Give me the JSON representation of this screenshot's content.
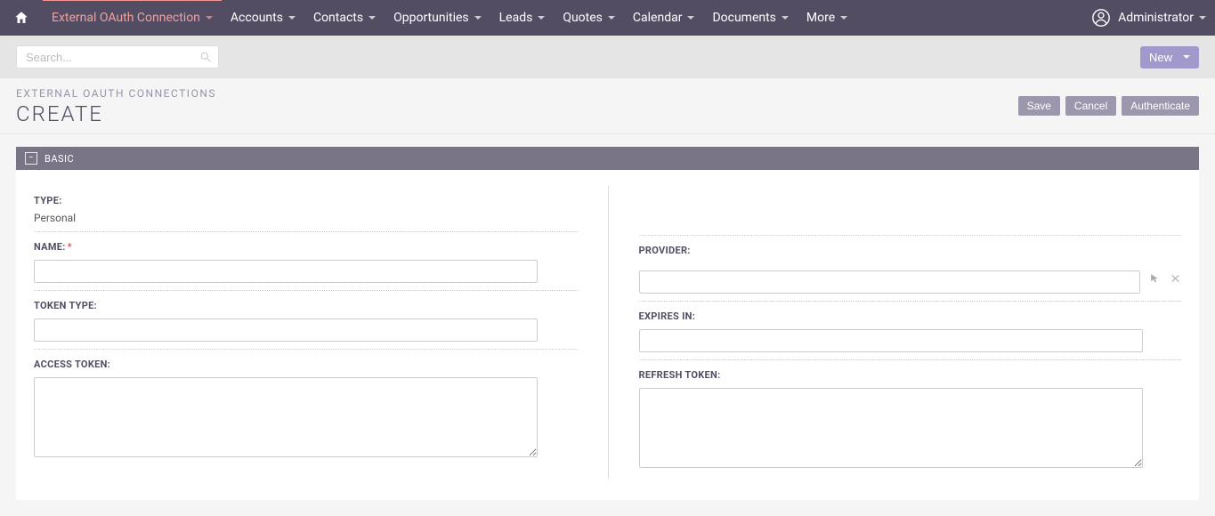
{
  "nav": {
    "active": "External OAuth Connection",
    "items": [
      "Accounts",
      "Contacts",
      "Opportunities",
      "Leads",
      "Quotes",
      "Calendar",
      "Documents",
      "More"
    ],
    "user": "Administrator"
  },
  "toolbar": {
    "search_placeholder": "Search...",
    "new_label": "New"
  },
  "page": {
    "breadcrumb": "EXTERNAL OAUTH CONNECTIONS",
    "title": "CREATE",
    "actions": {
      "save": "Save",
      "cancel": "Cancel",
      "authenticate": "Authenticate"
    }
  },
  "panel": {
    "title": "BASIC",
    "fields": {
      "type": {
        "label": "TYPE:",
        "value": "Personal"
      },
      "name": {
        "label": "NAME:",
        "required": "*",
        "value": ""
      },
      "token_type": {
        "label": "TOKEN TYPE:",
        "value": ""
      },
      "access_token": {
        "label": "ACCESS TOKEN:",
        "value": ""
      },
      "provider": {
        "label": "PROVIDER:",
        "value": ""
      },
      "expires_in": {
        "label": "EXPIRES IN:",
        "value": ""
      },
      "refresh_token": {
        "label": "REFRESH TOKEN:",
        "value": ""
      }
    }
  }
}
